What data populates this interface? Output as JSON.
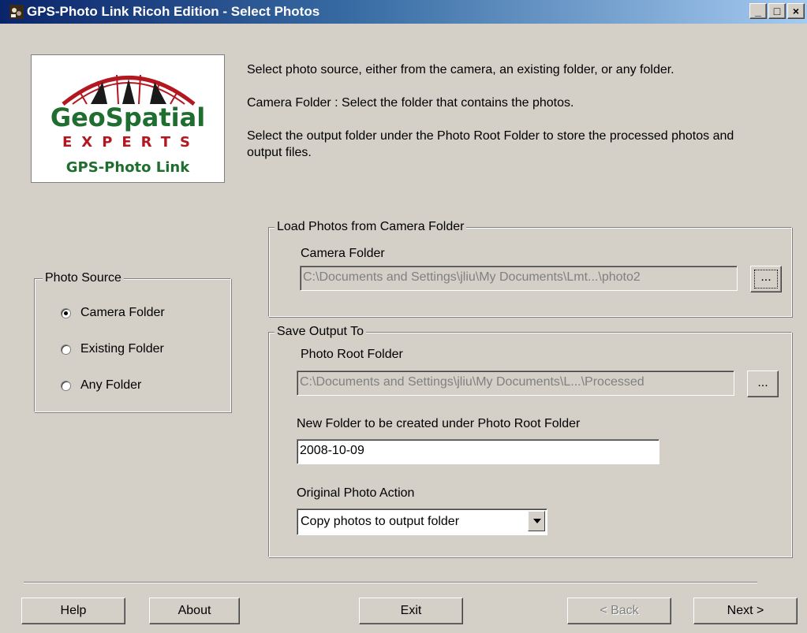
{
  "window": {
    "title": "GPS-Photo Link Ricoh Edition - Select Photos",
    "minimize": "_",
    "maximize": "□",
    "close": "×"
  },
  "logo": {
    "line1": "GeoSpatial",
    "line2": "EXPERTS",
    "line3": "GPS-Photo Link"
  },
  "instructions": {
    "p1": "Select photo source, either from the camera, an existing folder, or any folder.",
    "p2": "Camera Folder : Select the folder that contains the photos.",
    "p3": "Select the output folder under the Photo Root Folder to store the processed photos and output files."
  },
  "photo_source": {
    "legend": "Photo Source",
    "options": [
      {
        "label": "Camera Folder",
        "checked": true
      },
      {
        "label": "Existing Folder",
        "checked": false
      },
      {
        "label": "Any Folder",
        "checked": false
      }
    ]
  },
  "load_group": {
    "legend": "Load Photos from Camera Folder",
    "camera_folder_label": "Camera Folder",
    "camera_folder_value": "C:\\Documents and Settings\\jliu\\My Documents\\Lmt...\\photo2",
    "browse": "..."
  },
  "save_group": {
    "legend": "Save Output To",
    "root_label": "Photo Root Folder",
    "root_value": "C:\\Documents and Settings\\jliu\\My Documents\\L...\\Processed",
    "browse": "...",
    "new_folder_label": "New Folder to be created under Photo Root Folder",
    "new_folder_value": "2008-10-09",
    "action_label": "Original Photo Action",
    "action_value": "Copy photos to output folder"
  },
  "buttons": {
    "help": "Help",
    "about": "About",
    "exit": "Exit",
    "back": "< Back",
    "next": "Next >"
  }
}
